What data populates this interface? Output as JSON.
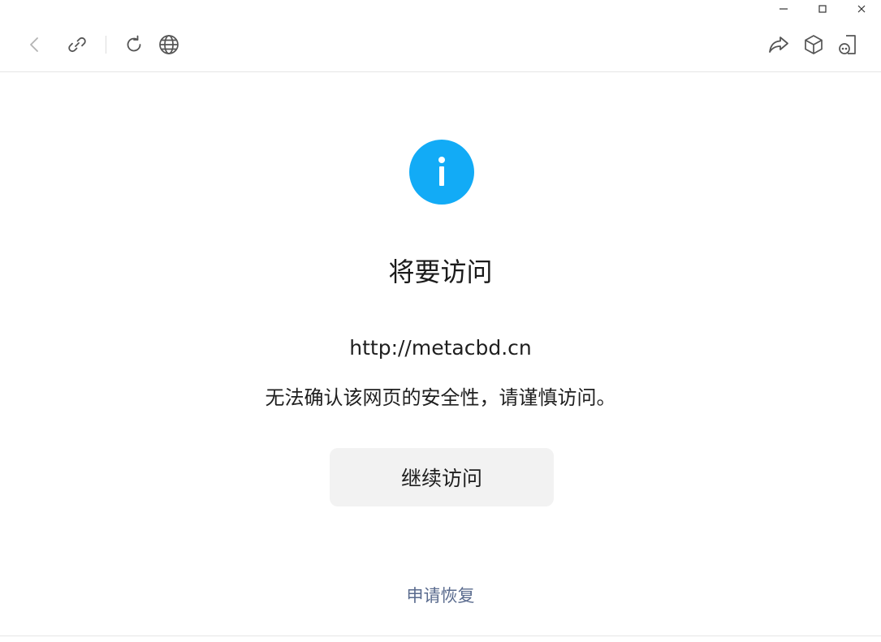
{
  "window_controls": {
    "minimize_icon": "minimize-icon",
    "maximize_icon": "maximize-icon",
    "close_icon": "close-icon"
  },
  "toolbar": {
    "left_icons": [
      "back-arrow-icon",
      "link-icon",
      "refresh-icon",
      "globe-icon"
    ],
    "right_icons": [
      "share-icon",
      "cube-icon",
      "mini-program-icon"
    ]
  },
  "main": {
    "status_icon": "info-icon",
    "title": "将要访问",
    "url": "http://metacbd.cn",
    "warning": "无法确认该网页的安全性，请谨慎访问。",
    "continue_label": "继续访问",
    "restore_label": "申请恢复"
  },
  "colors": {
    "accent": "#12abf6",
    "link": "#5a6b8e",
    "button_bg": "#f2f2f2"
  }
}
